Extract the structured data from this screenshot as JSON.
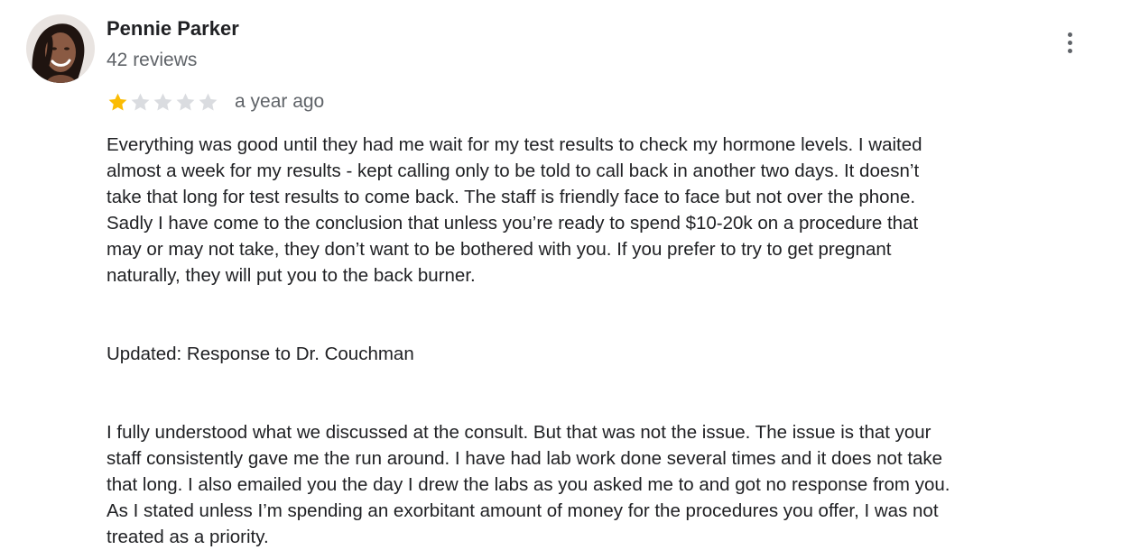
{
  "review": {
    "author": {
      "name": "Pennie Parker",
      "reviews_count": "42 reviews",
      "avatar_icon": "profile-photo"
    },
    "rating": {
      "value": 1,
      "max": 5,
      "filled_color": "#fbbc04",
      "empty_color": "#dadce0"
    },
    "date": "a year ago",
    "more_icon": "more-vert-icon",
    "body": {
      "paragraph_1": "Everything was good until they had me wait for my test results to check my hormone levels. I waited\nalmost a week for my results - kept calling only to be told to call back in another two days. It doesn’t\ntake that long for test results to come back. The staff is friendly face to face but not over the phone.\nSadly I have come to the conclusion that unless you’re ready to spend $10-20k on a procedure that\nmay or may not take, they don’t want to be bothered with you. If you prefer to try to get pregnant\nnaturally, they will put you to the back burner.",
      "update_heading": "Updated: Response to Dr. Couchman",
      "paragraph_2": "I fully understood what we discussed at the consult. But that was not the issue. The issue is that your\nstaff consistently gave me the run around. I have had lab work done several times and it does not take\nthat long. I also emailed you the day I drew the labs as you asked me to and got no response from you.\nAs I stated unless I’m spending an exorbitant amount of money for the procedures you offer, I was not\ntreated as a priority."
    }
  }
}
